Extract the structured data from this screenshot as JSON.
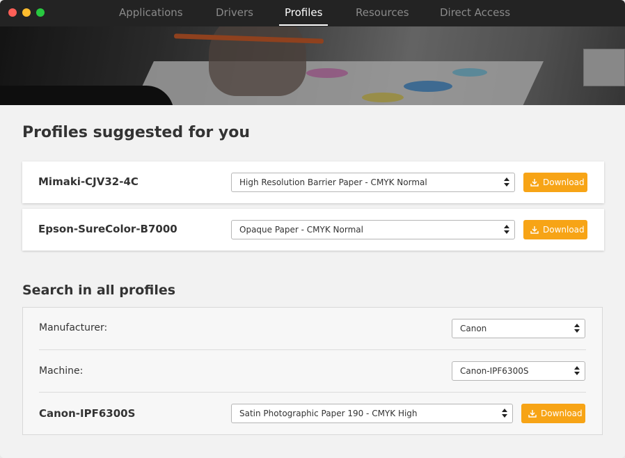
{
  "window": {
    "nav": {
      "tabs": [
        {
          "label": "Applications",
          "active": false
        },
        {
          "label": "Drivers",
          "active": false
        },
        {
          "label": "Profiles",
          "active": true
        },
        {
          "label": "Resources",
          "active": false
        },
        {
          "label": "Direct Access",
          "active": false
        }
      ]
    }
  },
  "suggested": {
    "title": "Profiles suggested for you",
    "items": [
      {
        "machine": "Mimaki-CJV32-4C",
        "profile": "High Resolution Barrier Paper - CMYK Normal",
        "download_label": "Download"
      },
      {
        "machine": "Epson-SureColor-B7000",
        "profile": "Opaque Paper - CMYK Normal",
        "download_label": "Download"
      }
    ]
  },
  "search": {
    "title": "Search in all profiles",
    "manufacturer_label": "Manufacturer:",
    "manufacturer_value": "Canon",
    "machine_label": "Machine:",
    "machine_value": "Canon-IPF6300S",
    "result": {
      "machine": "Canon-IPF6300S",
      "profile": "Satin Photographic Paper 190 - CMYK High",
      "download_label": "Download"
    }
  },
  "colors": {
    "accent": "#f7a416",
    "titlebar": "#232323"
  },
  "icons": {
    "download": "download-icon",
    "select_arrows": "updown-arrows-icon"
  }
}
